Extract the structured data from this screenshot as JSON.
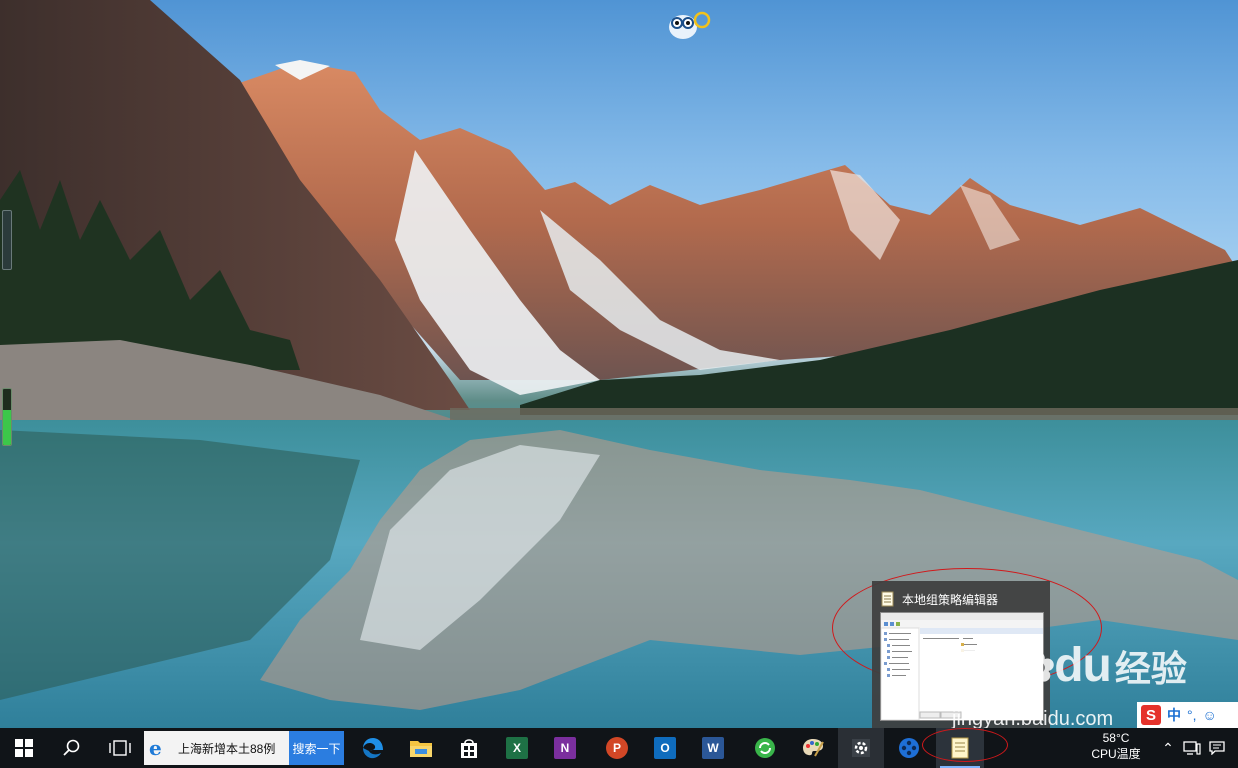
{
  "preview": {
    "title": "本地组策略编辑器",
    "thumb_lines": [
      "计算机配置",
      "用户配置",
      "设置",
      "策略"
    ]
  },
  "watermark": {
    "brand": "Bai",
    "brand_suffix": "du",
    "cn": "经验",
    "url": "jingyan.baidu.com"
  },
  "ime": {
    "logo": "S",
    "lang": "中",
    "punct": "°,"
  },
  "taskbar": {
    "search_text": "上海新增本土88例",
    "search_button": "搜索一下",
    "apps": [
      {
        "name": "edge",
        "label": "e"
      },
      {
        "name": "file-explorer",
        "label": ""
      },
      {
        "name": "store",
        "label": ""
      },
      {
        "name": "excel",
        "label": "X"
      },
      {
        "name": "onenote",
        "label": "N"
      },
      {
        "name": "powerpoint",
        "label": "P"
      },
      {
        "name": "outlook",
        "label": "O"
      },
      {
        "name": "word",
        "label": "W"
      }
    ],
    "temperature": "58°C",
    "temperature_label": "CPU温度"
  },
  "colors": {
    "taskbar": "#101418",
    "accent": "#2b7de0",
    "highlight": "#d0191b"
  },
  "meter": {
    "level_percent": 62
  }
}
